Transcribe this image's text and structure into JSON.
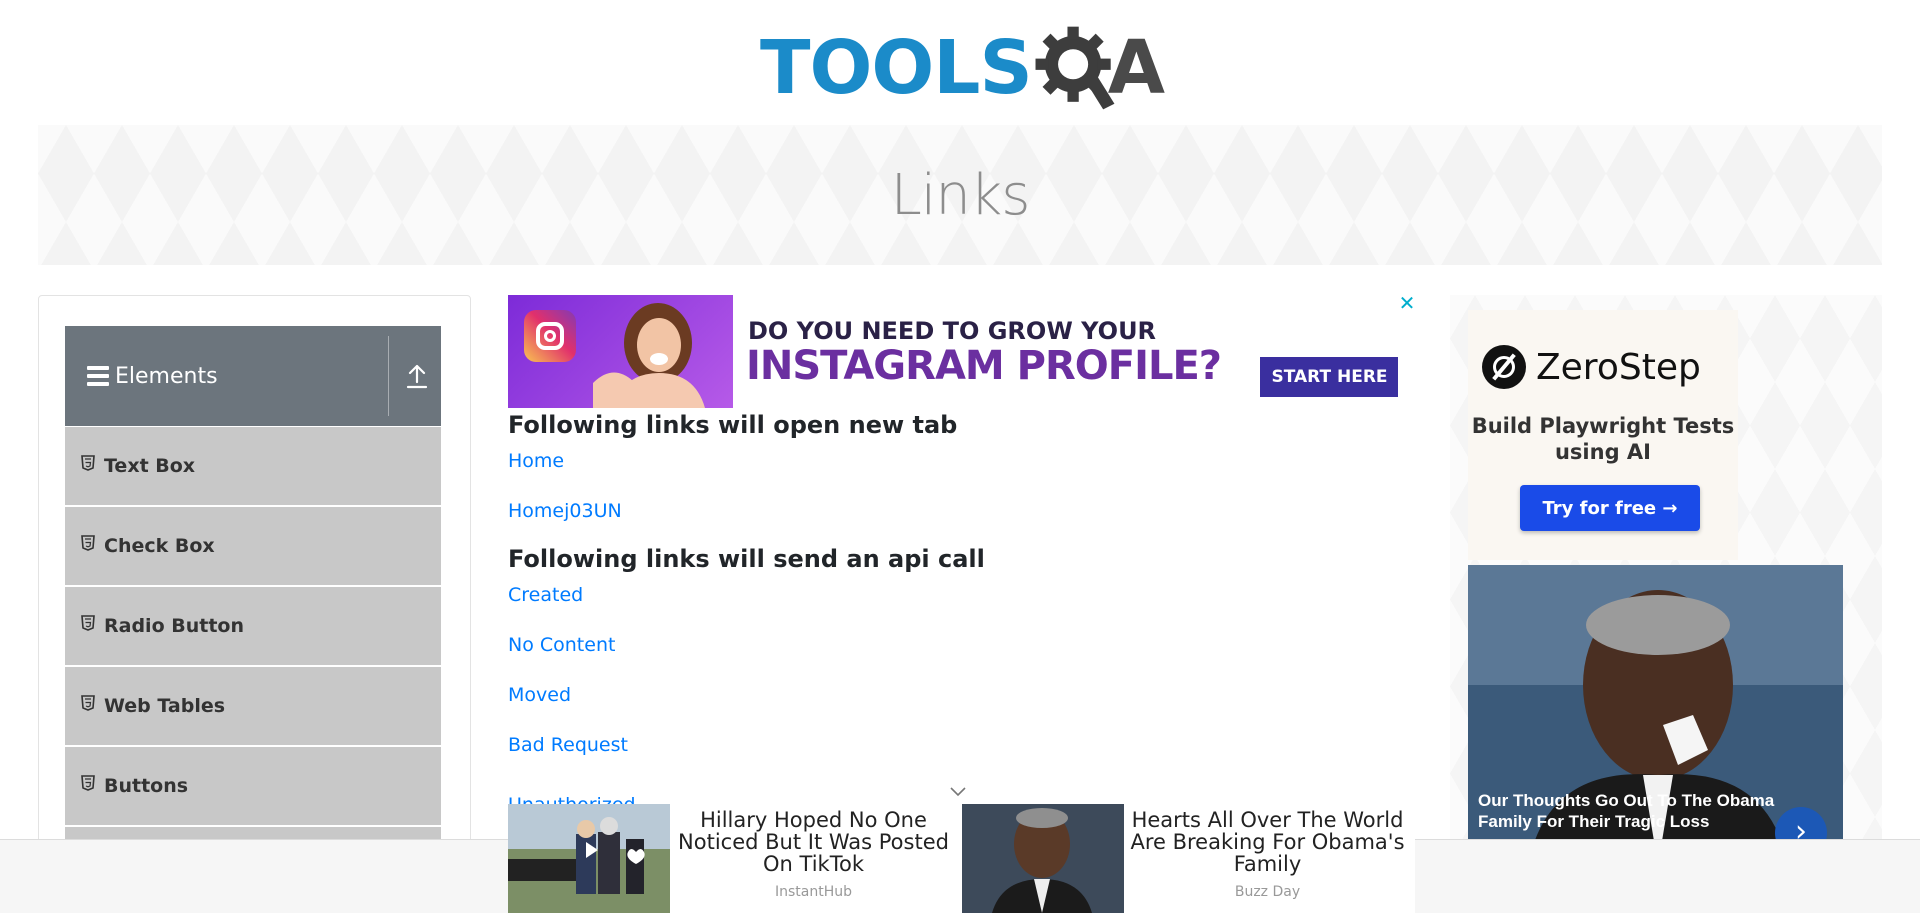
{
  "logo": {
    "text_main": "TOOLS",
    "text_end": "A"
  },
  "banner": {
    "title": "Links"
  },
  "sidebar": {
    "group_title": "Elements",
    "items": [
      {
        "label": "Text Box"
      },
      {
        "label": "Check Box"
      },
      {
        "label": "Radio Button"
      },
      {
        "label": "Web Tables"
      },
      {
        "label": "Buttons"
      }
    ]
  },
  "top_ad": {
    "line1": "DO YOU NEED TO GROW YOUR",
    "line2": "INSTAGRAM PROFILE?",
    "cta": "START HERE",
    "close_glyph": "✕"
  },
  "content": {
    "heading_new_tab": "Following links will open new tab",
    "new_tab_links": [
      "Home",
      "Homej03UN"
    ],
    "heading_api": "Following links will send an api call",
    "api_links": [
      "Created",
      "No Content",
      "Moved",
      "Bad Request"
    ],
    "partial_link": "Unauthorized"
  },
  "right_ad": {
    "brand": "ZeroStep",
    "tagline": "Build Playwright Tests using AI",
    "button": "Try for free →",
    "news_caption": "Our Thoughts Go Out To The Obama Family For Their Tragic Loss",
    "next_glyph": "›"
  },
  "bottom_ads": [
    {
      "title": "Hillary Hoped No One Noticed But It Was Posted On TikTok",
      "source": "InstantHub"
    },
    {
      "title": "Hearts All Over The World Are Breaking For Obama's Family",
      "source": "Buzz Day"
    }
  ],
  "colors": {
    "logo_blue": "#1b8bc9",
    "logo_dark": "#4a4a4a",
    "sidebar_header": "#6c757d",
    "sidebar_item": "#c8c8c8",
    "link": "#007bff",
    "heading": "#212529",
    "banner_title": "#8d8d8d",
    "cta_button": "#1a4be8"
  }
}
